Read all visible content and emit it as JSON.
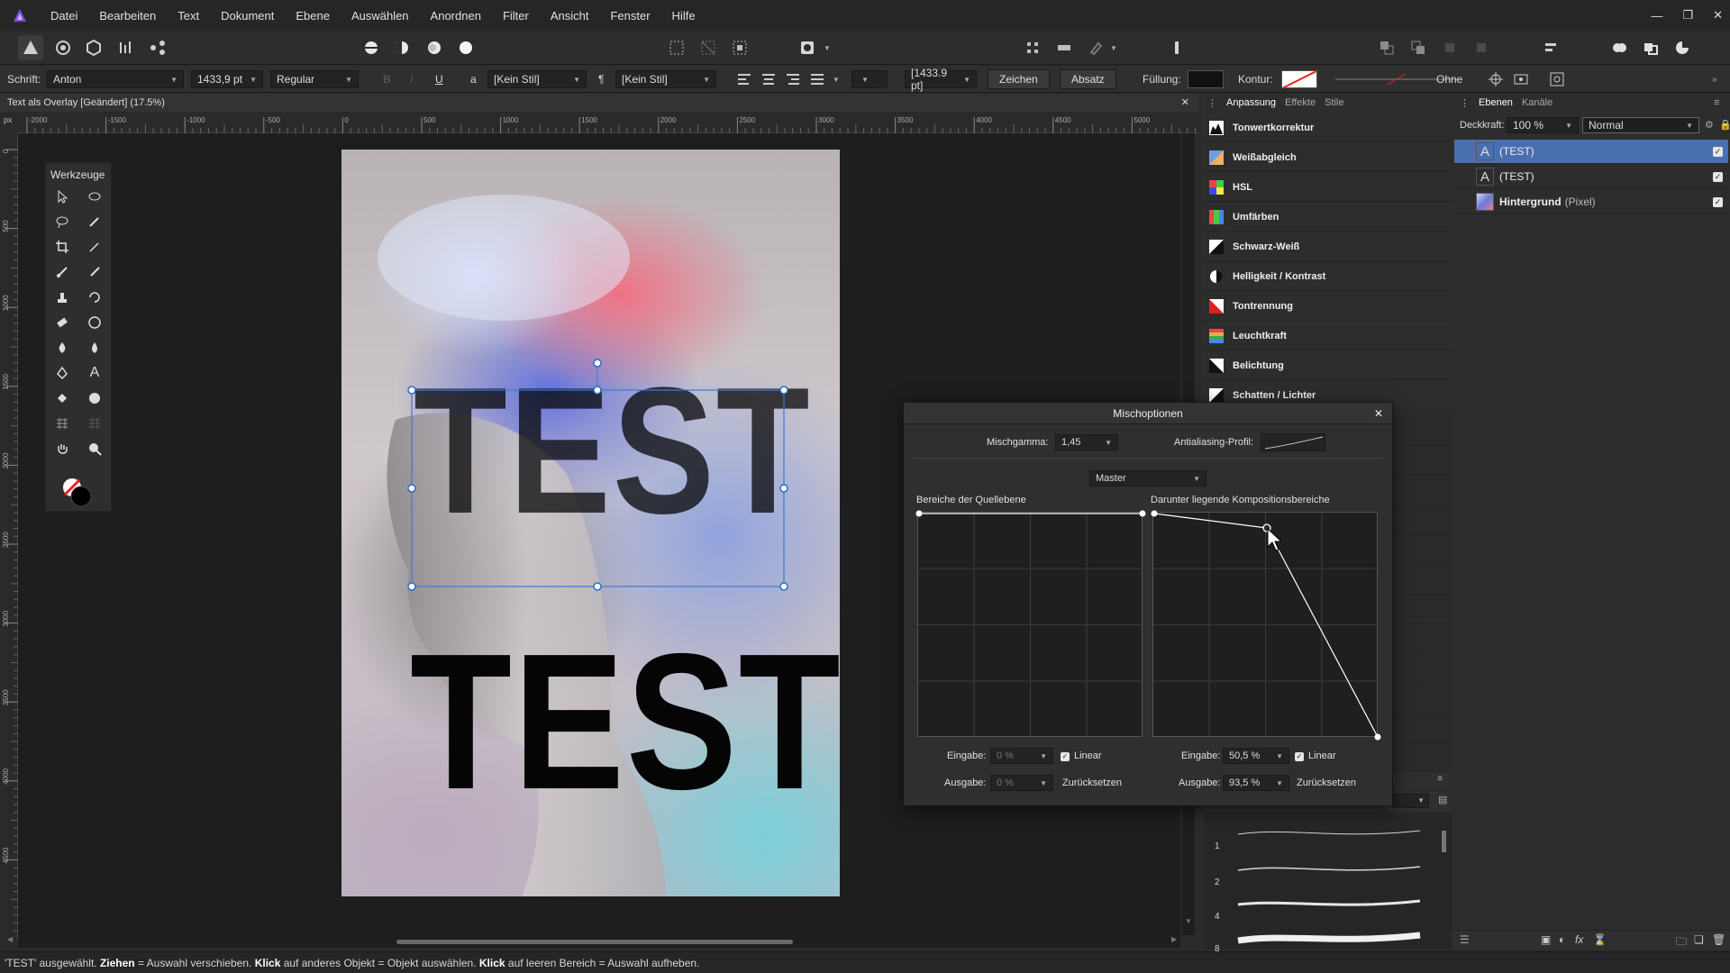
{
  "menu": {
    "items": [
      "Datei",
      "Bearbeiten",
      "Text",
      "Dokument",
      "Ebene",
      "Auswählen",
      "Anordnen",
      "Filter",
      "Ansicht",
      "Fenster",
      "Hilfe"
    ]
  },
  "context_bar": {
    "font_label": "Schrift:",
    "font_value": "Anton",
    "size_value": "1433,9 pt",
    "style_value": "Regular",
    "underline_label": "U",
    "char_style_label": "a",
    "char_style_value": "[Kein Stil]",
    "para_style_label": "¶",
    "para_style_value": "[Kein Stil]",
    "leading_value": "[1433.9 pt]",
    "zeichen_button": "Zeichen",
    "absatz_button": "Absatz",
    "fill_label": "Füllung:",
    "fill_color": "#111111",
    "stroke_label": "Kontur:",
    "stroke_none": "Ohne"
  },
  "document": {
    "tab_title": "Text als Overlay [Geändert] (17.5%)",
    "ruler_unit": "px",
    "h_ticks": [
      "-2000",
      "-1500",
      "-1000",
      "-500",
      "0",
      "500",
      "1000",
      "1500",
      "2000",
      "2500",
      "3000",
      "3500",
      "4000",
      "4500",
      "5000"
    ],
    "v_ticks": [
      "0",
      "500",
      "1000",
      "1500",
      "2000",
      "2500",
      "3000",
      "3500",
      "4000",
      "4500"
    ],
    "poster_text_top": "TEST",
    "poster_text_bottom": "TEST"
  },
  "tools_panel": {
    "title": "Werkzeuge"
  },
  "adjustments": {
    "tabs": [
      "Anpassung",
      "Effekte",
      "Stile"
    ],
    "items": [
      {
        "label": "Tonwertkorrektur",
        "icon": "levels-icon"
      },
      {
        "label": "Weißabgleich",
        "icon": "white-balance-icon"
      },
      {
        "label": "HSL",
        "icon": "hsl-icon"
      },
      {
        "label": "Umfärben",
        "icon": "recolor-icon"
      },
      {
        "label": "Schwarz-Weiß",
        "icon": "black-white-icon"
      },
      {
        "label": "Helligkeit / Kontrast",
        "icon": "brightness-contrast-icon"
      },
      {
        "label": "Tontrennung",
        "icon": "posterize-icon"
      },
      {
        "label": "Leuchtkraft",
        "icon": "vibrance-icon"
      },
      {
        "label": "Belichtung",
        "icon": "exposure-icon"
      },
      {
        "label": "Schatten / Lichter",
        "icon": "shadows-highlights-icon"
      }
    ],
    "brush_sizes": [
      "1",
      "2",
      "4",
      "8"
    ]
  },
  "layers": {
    "tabs": [
      "Ebenen",
      "Kanäle"
    ],
    "opacity_label": "Deckkraft:",
    "opacity_value": "100 %",
    "blend_mode": "Normal",
    "items": [
      {
        "name": "(TEST)",
        "extra": "",
        "selected": true
      },
      {
        "name": "(TEST)",
        "extra": "",
        "selected": false
      },
      {
        "name": "Hintergrund",
        "extra": "(Pixel)",
        "selected": false
      }
    ]
  },
  "dialog": {
    "title": "Mischoptionen",
    "gamma_label": "Mischgamma:",
    "gamma_value": "1,45",
    "aa_label": "Antialiasing-Profil:",
    "channel_value": "Master",
    "left_title": "Bereiche der Quellebene",
    "right_title": "Darunter liegende Kompositionsbereiche",
    "left": {
      "input_label": "Eingabe:",
      "input_value": "0 %",
      "output_label": "Ausgabe:",
      "output_value": "0 %",
      "linear_label": "Linear",
      "reset_label": "Zurücksetzen"
    },
    "right": {
      "input_label": "Eingabe:",
      "input_value": "50,5 %",
      "output_label": "Ausgabe:",
      "output_value": "93,5 %",
      "linear_label": "Linear",
      "reset_label": "Zurücksetzen"
    }
  },
  "status": {
    "p1": "'TEST' ausgewählt. ",
    "b1": "Ziehen",
    "p2": " = Auswahl verschieben. ",
    "b2": "Klick",
    "p3": " auf anderes Objekt = Objekt auswählen. ",
    "b3": "Klick",
    "p4": " auf leeren Bereich = Auswahl aufheben."
  }
}
